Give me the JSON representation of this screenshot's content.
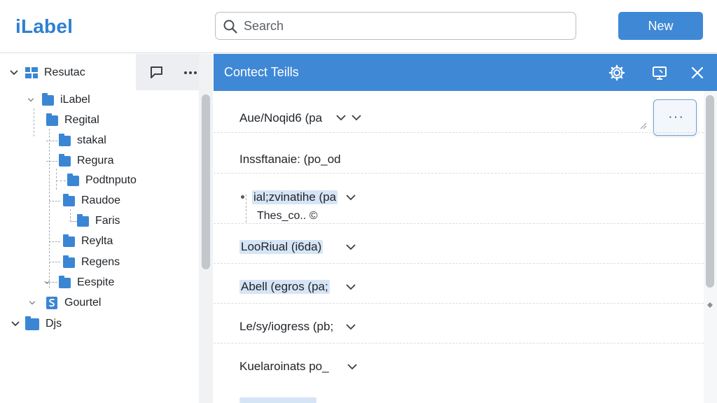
{
  "app": {
    "title": "iLabel"
  },
  "search": {
    "placeholder": "Search"
  },
  "header": {
    "new_label": "New"
  },
  "sidebar": {
    "tree": [
      {
        "label": "Resutac",
        "level": 0,
        "icon": "grid-icon"
      },
      {
        "label": "iLabel",
        "level": 1,
        "icon": "folder-icon"
      },
      {
        "label": "Regital",
        "level": 2,
        "icon": "folder-icon"
      },
      {
        "label": "stakal",
        "level": 3,
        "icon": "folder-icon"
      },
      {
        "label": "Regura",
        "level": 3,
        "icon": "folder-icon"
      },
      {
        "label": "Podtnputo",
        "level": 4,
        "icon": "folder-icon"
      },
      {
        "label": "Raudoe",
        "level": 3,
        "icon": "folder-icon"
      },
      {
        "label": "Faris",
        "level": 4,
        "icon": "folder-icon"
      },
      {
        "label": "Reylta",
        "level": 3,
        "icon": "folder-icon"
      },
      {
        "label": "Regens",
        "level": 3,
        "icon": "folder-icon"
      },
      {
        "label": "Eespite",
        "level": 3,
        "icon": "folder-icon"
      },
      {
        "label": "Gourtel",
        "level": 2,
        "icon": "s-doc-icon"
      },
      {
        "label": "Djs",
        "level": 0,
        "icon": "folder-icon"
      }
    ]
  },
  "panel": {
    "title": "Contect Teills",
    "more": "···",
    "fields": [
      {
        "label": "Aue/Noqid6 (pa",
        "highlight": false
      },
      {
        "label": "Inssftanaie: (po_od",
        "highlight": false
      },
      {
        "label": "ial;zvinatihe (pa",
        "highlight": true,
        "sub": "Thes_co.. ©"
      },
      {
        "label": "LooRiual (i6da)",
        "highlight": true
      },
      {
        "label": "Abell (egros (pa;",
        "highlight": true
      },
      {
        "label": "Le/sy/iogress (pb;",
        "highlight": false
      },
      {
        "label": "Kuelaroinats po_",
        "highlight": false
      }
    ]
  },
  "colors": {
    "accent": "#3f88d6",
    "logo": "#2f80d1",
    "folder": "#3b86d4",
    "highlight": "#d6e5f6"
  }
}
